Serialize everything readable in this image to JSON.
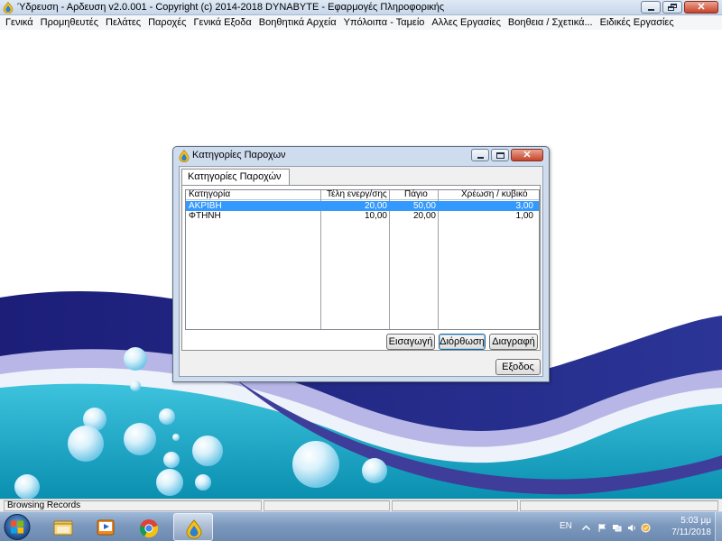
{
  "app": {
    "title": "Ύδρευση - Αρδευση  v2.0.001  -  Copyright (c) 2014-2018  DYNABYTE - Εφαρμογές Πληροφορικής"
  },
  "menu": [
    "Γενικά",
    "Προμηθευτές",
    "Πελάτες",
    "Παροχές",
    "Γενικά Εξοδα",
    "Βοηθητικά Αρχεία",
    "Υπόλοιπα - Ταμείο",
    "Αλλες Εργασίες",
    "Βοηθεια / Σχετικά...",
    "Ειδικές Εργασίες"
  ],
  "dialog": {
    "title": "Κατηγορίες Παροχων",
    "tab_label": "Κατηγορίες Παροχών",
    "columns": [
      "Κατηγορία",
      "Τέλη ενεργ/σης",
      "Πάγιο",
      "Χρέωση / κυβικό"
    ],
    "rows": [
      {
        "category": "ΑΚΡΙΒΗ",
        "fees": "20,00",
        "fixed": "50,00",
        "per_cubic": "3,00",
        "selected": true
      },
      {
        "category": "ΦΤΗΝΗ",
        "fees": "10,00",
        "fixed": "20,00",
        "per_cubic": "1,00",
        "selected": false
      }
    ],
    "buttons": {
      "insert": "Εισαγωγή",
      "edit": "Διόρθωση",
      "delete": "Διαγραφή",
      "exit": "Εξοδος"
    }
  },
  "statusbar": {
    "text": "Browsing Records"
  },
  "taskbar": {
    "language": "EN",
    "time": "5:03 μμ",
    "date": "7/11/2018",
    "pinned_icons": [
      "windows-explorer-icon",
      "media-player-icon",
      "chrome-icon",
      "water-app-icon"
    ]
  },
  "colors": {
    "selection": "#3399ff",
    "title_bar": "#c6d6ea",
    "wave_dark": "#1c1e78",
    "wave_teal": "#1fa9c4"
  }
}
